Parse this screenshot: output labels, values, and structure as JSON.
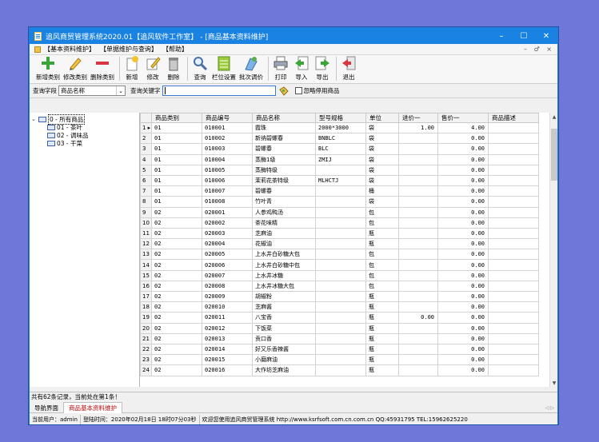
{
  "window": {
    "title": "追风商贸管理系统2020.01【追风软件工作室】 - [商品基本资料维护]",
    "controls": [
      "–",
      "☐",
      "✕"
    ]
  },
  "menu": {
    "items": [
      "【基本资料维护】",
      "【单据维护与查询】",
      "【帮助】"
    ],
    "right": "– ♂ ×"
  },
  "toolbar": [
    {
      "label": "新增类别",
      "icon": "add-category-icon"
    },
    {
      "label": "修改类别",
      "icon": "edit-category-icon"
    },
    {
      "label": "删除类别",
      "icon": "delete-category-icon"
    },
    {
      "label": "新增",
      "icon": "new-icon"
    },
    {
      "label": "修改",
      "icon": "edit-icon"
    },
    {
      "label": "删除",
      "icon": "trash-icon"
    },
    {
      "label": "查询",
      "icon": "magnifier-icon"
    },
    {
      "label": "栏位设置",
      "icon": "columns-icon"
    },
    {
      "label": "批次调价",
      "icon": "batch-price-icon"
    },
    {
      "label": "打印",
      "icon": "printer-icon"
    },
    {
      "label": "导入",
      "icon": "import-icon"
    },
    {
      "label": "导出",
      "icon": "export-icon"
    },
    {
      "label": "退出",
      "icon": "exit-icon"
    }
  ],
  "search": {
    "field_label": "查询字段",
    "field_value": "商品名称",
    "keyword_label": "查询关键字",
    "keyword_value": "",
    "ignore_label": "忽略停用商品"
  },
  "tree": {
    "root": "0 - 所有商品",
    "children": [
      "01 - 茶叶",
      "02 - 调味品",
      "03 - 干菜"
    ]
  },
  "grid": {
    "columns": [
      "商品类别",
      "商品编号",
      "商品名称",
      "型号规格",
      "单位",
      "进价一",
      "售价一",
      "商品描述"
    ],
    "rows": [
      [
        "1",
        "01",
        "010001",
        "霞珠",
        "2000*3000",
        "袋",
        "1.00",
        "4.00",
        ""
      ],
      [
        "2",
        "01",
        "010002",
        "新纳碧螺春",
        "BNBLC",
        "袋",
        "",
        "0.00",
        ""
      ],
      [
        "3",
        "01",
        "010003",
        "碧螺春",
        "BLC",
        "袋",
        "",
        "0.00",
        ""
      ],
      [
        "4",
        "01",
        "010004",
        "蒸酶1级",
        "ZMIJ",
        "袋",
        "",
        "0.00",
        ""
      ],
      [
        "5",
        "01",
        "010005",
        "蒸酶特级",
        "",
        "袋",
        "",
        "0.00",
        ""
      ],
      [
        "6",
        "01",
        "010006",
        "茉莉花茶特级",
        "MLHCTJ",
        "袋",
        "",
        "0.00",
        ""
      ],
      [
        "7",
        "01",
        "010007",
        "碧螺春",
        "",
        "桶",
        "",
        "0.00",
        ""
      ],
      [
        "8",
        "01",
        "010008",
        "竹叶青",
        "",
        "袋",
        "",
        "0.00",
        ""
      ],
      [
        "9",
        "02",
        "020001",
        "人参鸡鸭汤",
        "",
        "包",
        "",
        "0.00",
        ""
      ],
      [
        "10",
        "02",
        "020002",
        "茶花味精",
        "",
        "包",
        "",
        "0.00",
        ""
      ],
      [
        "11",
        "02",
        "020003",
        "芝麻油",
        "",
        "瓶",
        "",
        "0.00",
        ""
      ],
      [
        "12",
        "02",
        "020004",
        "花椒油",
        "",
        "瓶",
        "",
        "0.00",
        ""
      ],
      [
        "13",
        "02",
        "020005",
        "上水井白砂糖大包",
        "",
        "包",
        "",
        "0.00",
        ""
      ],
      [
        "14",
        "02",
        "020006",
        "上水井白砂糖中包",
        "",
        "包",
        "",
        "0.00",
        ""
      ],
      [
        "15",
        "02",
        "020007",
        "上水井冰糖",
        "",
        "包",
        "",
        "0.00",
        ""
      ],
      [
        "16",
        "02",
        "020008",
        "上水井冰糖大包",
        "",
        "包",
        "",
        "0.00",
        ""
      ],
      [
        "17",
        "02",
        "020009",
        "胡椒粉",
        "",
        "瓶",
        "",
        "0.00",
        ""
      ],
      [
        "18",
        "02",
        "020010",
        "芝麻酱",
        "",
        "瓶",
        "",
        "0.00",
        ""
      ],
      [
        "19",
        "02",
        "020011",
        "八宝香",
        "",
        "瓶",
        "0.00",
        "0.00",
        ""
      ],
      [
        "20",
        "02",
        "020012",
        "下饭菜",
        "",
        "瓶",
        "",
        "0.00",
        ""
      ],
      [
        "21",
        "02",
        "020013",
        "贡口香",
        "",
        "瓶",
        "",
        "0.00",
        ""
      ],
      [
        "22",
        "02",
        "020014",
        "好又乐香辣酱",
        "",
        "瓶",
        "",
        "0.00",
        ""
      ],
      [
        "23",
        "02",
        "020015",
        "小磨麻油",
        "",
        "瓶",
        "",
        "0.00",
        ""
      ],
      [
        "24",
        "02",
        "020016",
        "大作坊芝麻油",
        "",
        "瓶",
        "",
        "0.00",
        ""
      ]
    ]
  },
  "record_status": "共有62条记录，当前处在第1条！",
  "tabs": [
    "导航界面",
    "商品基本资料维护"
  ],
  "statusbar": {
    "user": "当前用户：admin",
    "login": "登陆时间：2020年02月18日 18时07分03秒",
    "welcome": "欢迎您使用追风商贸管理系统 http://www.ksrfsoft.com.cn.com.cn QQ:45931795 TEL:15962625220"
  },
  "colors": {
    "titlebar": "#1a82e2",
    "background": "#6f78d8",
    "active_tab": "#c00000"
  }
}
